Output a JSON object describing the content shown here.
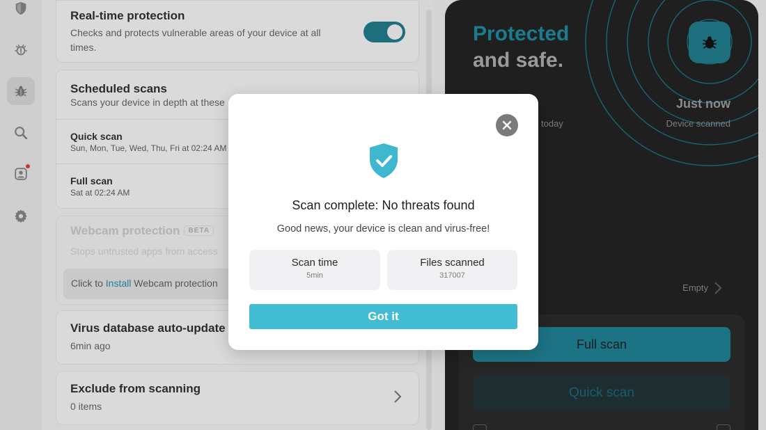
{
  "sidebar": {
    "items": [
      {
        "name": "shield-icon",
        "active": false
      },
      {
        "name": "alert-bug-icon",
        "active": false
      },
      {
        "name": "bug-icon",
        "active": true
      },
      {
        "name": "search-icon",
        "active": false
      },
      {
        "name": "account-icon",
        "active": false,
        "notification": true
      },
      {
        "name": "gear-icon",
        "active": false
      }
    ]
  },
  "settings": {
    "realtime": {
      "title": "Real-time protection",
      "description": "Checks and protects vulnerable areas of your device at all times.",
      "enabled": true
    },
    "scheduled": {
      "title": "Scheduled scans",
      "description": "Scans your device in depth at these",
      "quick_title": "Quick scan",
      "quick_desc": "Sun, Mon, Tue, Wed, Thu, Fri at 02:24 AM",
      "full_title": "Full scan",
      "full_desc": "Sat at 02:24 AM"
    },
    "webcam": {
      "title": "Webcam protection",
      "badge": "BETA",
      "description": "Stops untrusted apps from access",
      "install_prefix": "Click to ",
      "install_link": "Install",
      "install_suffix": " Webcam protection"
    },
    "database": {
      "title": "Virus database auto-update",
      "description": "6min ago"
    },
    "exclude": {
      "title": "Exclude from scanning",
      "description": "0 items"
    }
  },
  "panel": {
    "headline_1": "Protected",
    "headline_2": "and safe.",
    "last_scan_value": "Just now",
    "last_scan_label": "Device scanned",
    "today_label": "today",
    "empty_label": "Empty",
    "full_scan": "Full scan",
    "quick_scan": "Quick scan"
  },
  "modal": {
    "title": "Scan complete: No threats found",
    "subtitle": "Good news, your device is clean and virus-free!",
    "scan_time_label": "Scan time",
    "scan_time_value": "5min",
    "files_label": "Files scanned",
    "files_value": "317007",
    "button": "Got it"
  },
  "colors": {
    "accent": "#42bcd2",
    "accent_dark": "#1a7c8f",
    "panel_bg": "#1f1f1f"
  }
}
